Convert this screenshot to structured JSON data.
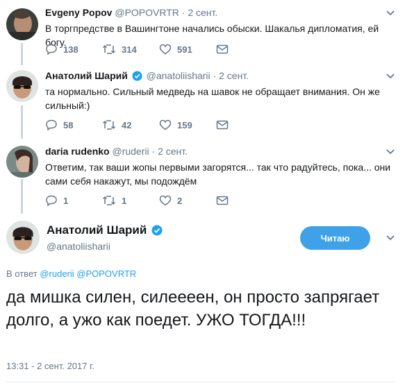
{
  "tweets": [
    {
      "name": "Evgeny Popov",
      "handle": "@POPOVRTR",
      "sep": "·",
      "date": "2 сент.",
      "text": "В торгпредстве в Вашингтоне начались обыски. Шакалья дипломатия, ей богу.",
      "replies": "138",
      "retweets": "314",
      "likes": "591"
    },
    {
      "name": "Анатолий Шарий",
      "handle": "@anatoliisharii",
      "sep": "·",
      "date": "2 сент.",
      "text": "та нормально. Сильный медведь на шавок не обращает внимания. Он же сильный:)",
      "replies": "58",
      "retweets": "42",
      "likes": "159"
    },
    {
      "name": "daria rudenko",
      "handle": "@ruderii",
      "sep": "·",
      "date": "2 сент.",
      "text": "Ответим, так ваши жопы первыми загорятся... так что радуйтесь, пока... они сами себя накажут, мы подождём",
      "replies": "1",
      "retweets": "1",
      "likes": "2"
    }
  ],
  "main": {
    "name": "Анатолий Шарий",
    "handle": "@anatoliisharii",
    "follow_label": "Читаю",
    "reply_prefix": "В ответ",
    "reply_to_1": "@ruderii",
    "reply_to_2": "@POPOVRTR",
    "text": "да мишка силен, силеееен, он просто запрягает долго, а ужо как поедет. УЖО ТОГДА!!!",
    "timestamp": "13:31 - 2 сент. 2017 г."
  },
  "colors": {
    "accent": "#1da1f2",
    "button": "#3fa2e8",
    "verified": "#1da1f2",
    "muted": "#657786",
    "thread_line": "#ccd6dd"
  },
  "icons": [
    "reply-icon",
    "retweet-icon",
    "like-icon",
    "message-icon",
    "verified-icon",
    "chevron-down-icon"
  ]
}
